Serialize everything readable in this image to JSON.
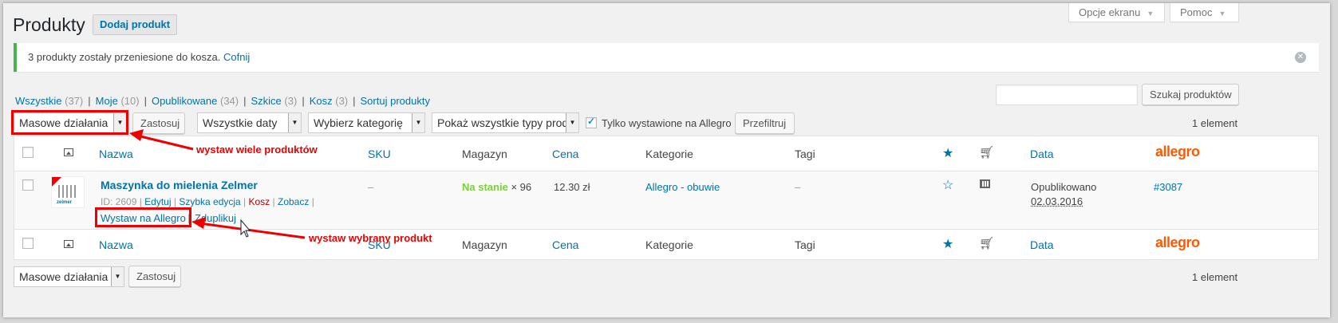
{
  "header": {
    "screen_options": "Opcje ekranu",
    "help": "Pomoc",
    "title": "Produkty",
    "add_new": "Dodaj produkt"
  },
  "notice": {
    "message": "3 produkty zostały przeniesione do kosza.",
    "undo": "Cofnij"
  },
  "views": [
    {
      "label": "Wszystkie",
      "count": "(37)"
    },
    {
      "label": "Moje",
      "count": "(10)"
    },
    {
      "label": "Opublikowane",
      "count": "(34)"
    },
    {
      "label": "Szkice",
      "count": "(3)"
    },
    {
      "label": "Kosz",
      "count": "(3)"
    },
    {
      "label": "Sortuj produkty",
      "count": ""
    }
  ],
  "search": {
    "button": "Szukaj produktów",
    "value": ""
  },
  "filters": {
    "bulk_actions": "Masowe działania",
    "apply": "Zastosuj",
    "dates": "Wszystkie daty",
    "category": "Wybierz kategorię",
    "types": "Pokaż wszystkie typy produ",
    "allegro_only": "Tylko wystawione na Allegro",
    "filter": "Przefiltruj",
    "count": "1 element"
  },
  "columns": {
    "name": "Nazwa",
    "sku": "SKU",
    "stock": "Magazyn",
    "price": "Cena",
    "categories": "Kategorie",
    "tags": "Tagi",
    "date": "Data",
    "allegro": "allegro"
  },
  "product": {
    "name": "Maszynka do mielenia Zelmer",
    "id": "ID: 2609",
    "actions": {
      "edit": "Edytuj",
      "quick_edit": "Szybka edycja",
      "trash": "Kosz",
      "view": "Zobacz",
      "list_allegro": "Wystaw na Allegro",
      "duplicate": "Zduplikuj"
    },
    "sku": "–",
    "stock_status": "Na stanie",
    "stock_qty": "× 96",
    "price": "12.30 zł",
    "category": "Allegro - obuwie",
    "tags": "–",
    "date_status": "Opublikowano",
    "date": "02.03.2016",
    "allegro_id": "#3087",
    "thumb_brand": "zelmer"
  },
  "bottom": {
    "bulk_actions": "Masowe działania",
    "apply": "Zastosuj",
    "count": "1 element"
  },
  "annotations": {
    "bulk": "wystaw wiele produktów",
    "single": "wystaw wybrany produkt"
  },
  "colors": {
    "accent": "#0073aa",
    "annotation": "#e00000",
    "allegro": "#ff5a00",
    "success": "#46b450"
  }
}
